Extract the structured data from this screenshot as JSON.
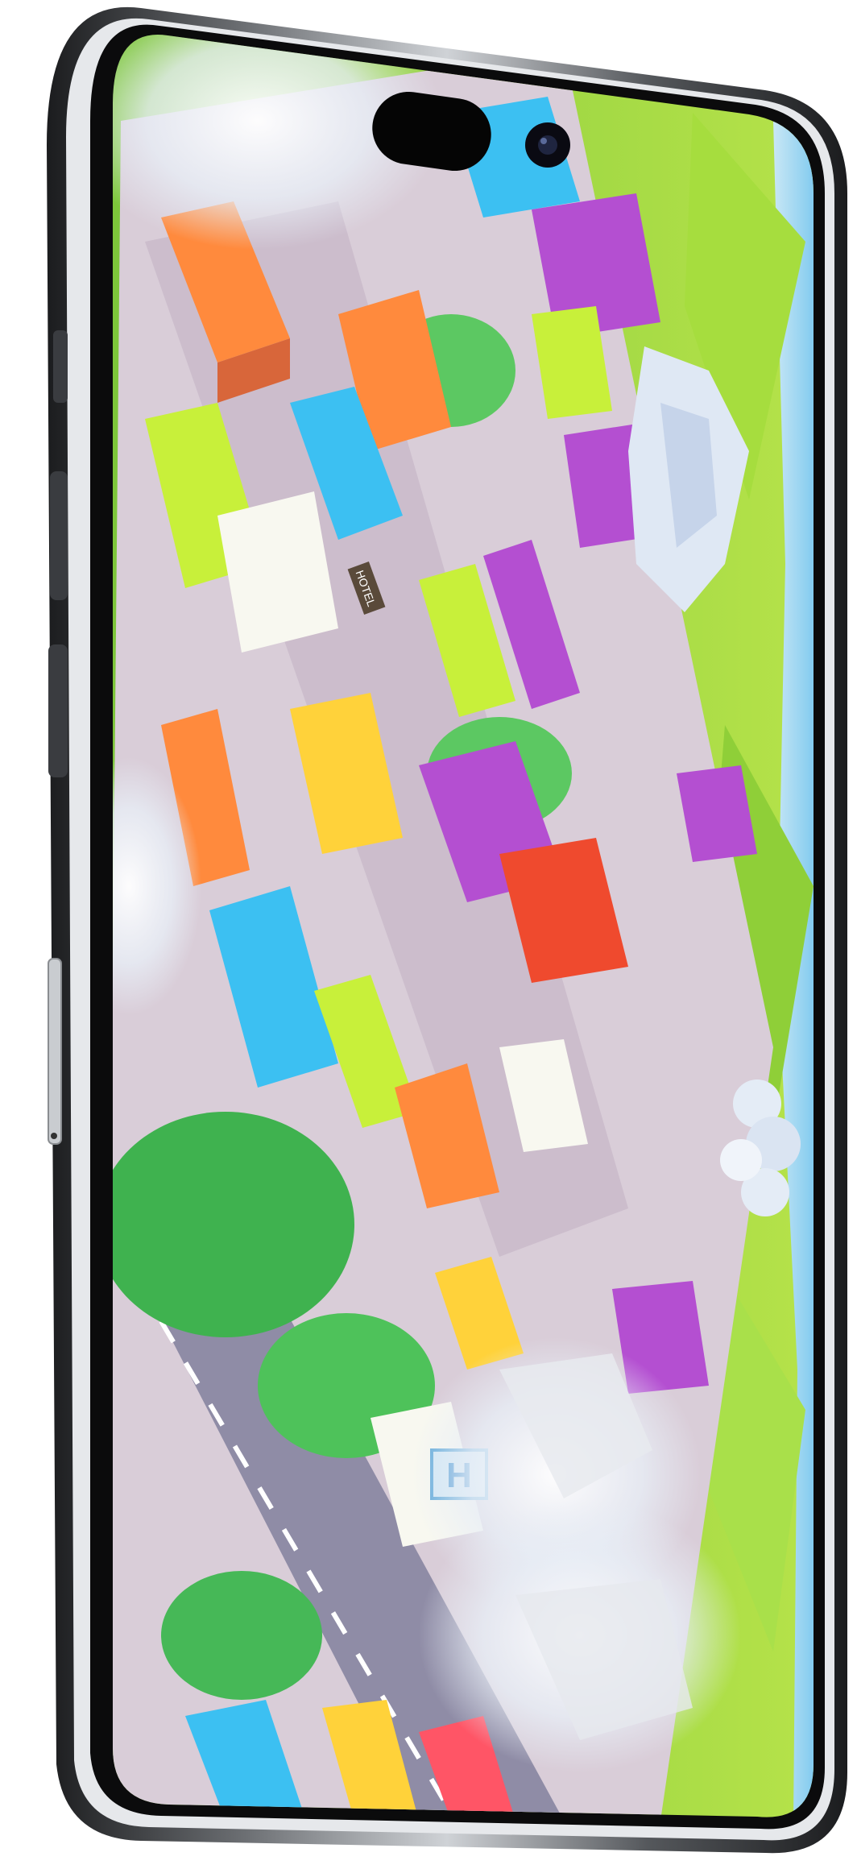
{
  "device": {
    "frame_color": "#2b2d30",
    "bezel_color": "#0a0a0a",
    "highlight_color": "#e9ebee"
  },
  "scene": {
    "sky_color": "#7ec8ef",
    "hill_color": "#9ad43c",
    "road_color": "#b9a6b8",
    "park_color": "#3fb24f",
    "cloud_color": "#dfe8f4",
    "building_colors": [
      "#ff8a3d",
      "#ffd23a",
      "#c8f03a",
      "#3cc0f2",
      "#b44fd1",
      "#ff5566",
      "#ef4a2e",
      "#f8f8f0"
    ]
  },
  "signs": {
    "hotel": "HOTEL",
    "hospital": "H"
  }
}
